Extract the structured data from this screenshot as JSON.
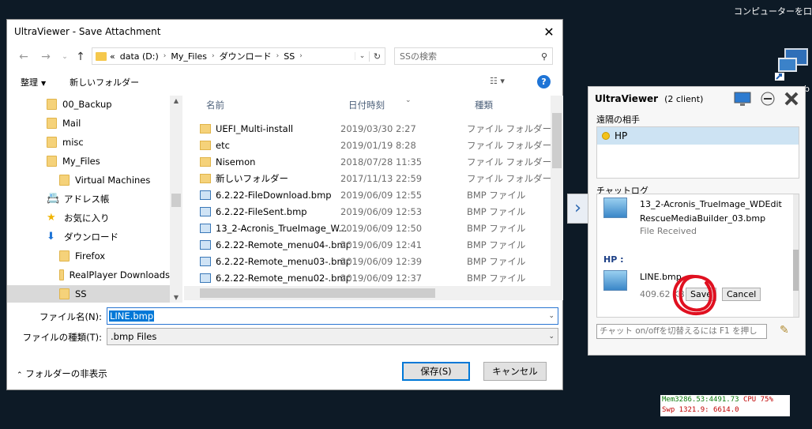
{
  "desktop": {
    "computer_label": "コンピューターを口",
    "mem_line1": "Mem3286.53:4491.73",
    "cpu_line1": "CPU 75%",
    "swp_line2": "Swp 1321.9: 6614.0"
  },
  "dialog": {
    "title": "UltraViewer - Save Attachment",
    "close_icon": "close-icon",
    "address": {
      "path": [
        "«",
        "data (D:)",
        "My_Files",
        "ダウンロード",
        "SS"
      ]
    },
    "search_placeholder": "SSの検索",
    "toolbar": {
      "organize": "整理",
      "new_folder": "新しいフォルダー",
      "view_icon": "view-icon",
      "help": "?"
    },
    "tree": [
      {
        "label": "00_Backup",
        "icon": "folder-icon",
        "level": 1
      },
      {
        "label": "Mail",
        "icon": "folder-icon",
        "level": 1
      },
      {
        "label": "misc",
        "icon": "folder-icon",
        "level": 1
      },
      {
        "label": "My_Files",
        "icon": "folder-icon",
        "level": 1
      },
      {
        "label": "Virtual Machines",
        "icon": "folder-icon",
        "level": 2
      },
      {
        "label": "アドレス帳",
        "icon": "contacts-icon",
        "level": 1
      },
      {
        "label": "お気に入り",
        "icon": "star-icon",
        "level": 1
      },
      {
        "label": "ダウンロード",
        "icon": "download-icon",
        "level": 1
      },
      {
        "label": "Firefox",
        "icon": "folder-icon",
        "level": 2
      },
      {
        "label": "RealPlayer Downloads",
        "icon": "folder-icon",
        "level": 2
      },
      {
        "label": "SS",
        "icon": "folder-icon",
        "level": 2,
        "selected": true
      }
    ],
    "columns": {
      "name": "名前",
      "date": "日付時刻",
      "type": "種類"
    },
    "files": [
      {
        "name": "UEFI_Multi-install",
        "date": "2019/03/30 2:27",
        "type": "ファイル フォルダー",
        "kind": "folder"
      },
      {
        "name": "etc",
        "date": "2019/01/19 8:28",
        "type": "ファイル フォルダー",
        "kind": "folder"
      },
      {
        "name": "Nisemon",
        "date": "2018/07/28 11:35",
        "type": "ファイル フォルダー",
        "kind": "folder"
      },
      {
        "name": "新しいフォルダー",
        "date": "2017/11/13 22:59",
        "type": "ファイル フォルダー",
        "kind": "folder"
      },
      {
        "name": "6.2.22-FileDownload.bmp",
        "date": "2019/06/09 12:55",
        "type": "BMP ファイル",
        "kind": "bmp"
      },
      {
        "name": "6.2.22-FileSent.bmp",
        "date": "2019/06/09 12:53",
        "type": "BMP ファイル",
        "kind": "bmp"
      },
      {
        "name": "13_2-Acronis_TrueImage_W...",
        "date": "2019/06/09 12:50",
        "type": "BMP ファイル",
        "kind": "bmp"
      },
      {
        "name": "6.2.22-Remote_menu04-.bmp",
        "date": "2019/06/09 12:41",
        "type": "BMP ファイル",
        "kind": "bmp"
      },
      {
        "name": "6.2.22-Remote_menu03-.bmp",
        "date": "2019/06/09 12:39",
        "type": "BMP ファイル",
        "kind": "bmp"
      },
      {
        "name": "6.2.22-Remote_menu02-.bmp",
        "date": "2019/06/09 12:37",
        "type": "BMP ファイル",
        "kind": "bmp"
      }
    ],
    "filename_label": "ファイル名(N):",
    "filename_value": "LINE.bmp",
    "filetype_label": "ファイルの種類(T):",
    "filetype_value": ".bmp Files",
    "hide_folders": "フォルダーの非表示",
    "save_button": "保存(S)",
    "cancel_button": "キャンセル"
  },
  "ultraviewer": {
    "title": "UltraViewer",
    "clients": "(2 client)",
    "partner_section": "遠隔の相手",
    "partner": "HP",
    "chat_section": "チャットログ",
    "chat": {
      "file1_name_a": "13_2-Acronis_TrueImage_WDEdit",
      "file1_name_b": "RescueMediaBuilder_03.bmp",
      "file1_status": "File Received",
      "sender": "HP :",
      "file2_name": "LINE.bmp",
      "file2_size": "409.62 KB",
      "save": "Save",
      "cancel": "Cancel"
    },
    "input_placeholder": "チャット on/offを切替えるには F1 を押し"
  },
  "colors": {
    "accent": "#0078d7",
    "desktop_bg": "#0d1a26",
    "annotation": "#e01020"
  }
}
